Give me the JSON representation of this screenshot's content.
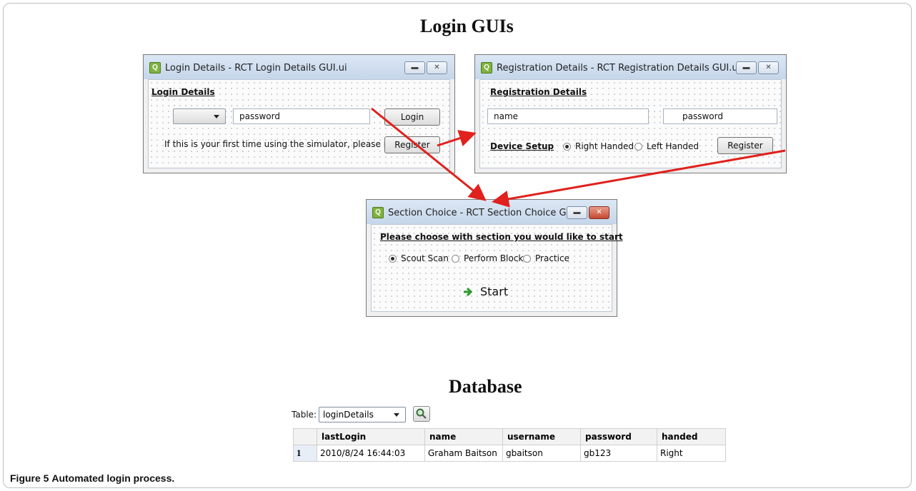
{
  "headings": {
    "top": "Login GUIs",
    "bottom": "Database"
  },
  "login_window": {
    "title": "Login Details - RCT Login Details GUI.ui",
    "section_label": "Login Details",
    "password_value": "password",
    "login_button": "Login",
    "register_prompt": "If this is your first time using the simulator, please register",
    "register_button": "Register"
  },
  "registration_window": {
    "title": "Registration Details - RCT Registration Details GUI.ui",
    "section_label": "Registration Details",
    "name_value": "name",
    "password_value": "password",
    "device_label": "Device Setup",
    "radio_right": "Right Handed",
    "radio_left": "Left Handed",
    "selected": "Right Handed",
    "register_button": "Register"
  },
  "section_window": {
    "title": "Section Choice - RCT Section Choice GUI.ui",
    "prompt": "Please choose with section you would like to start",
    "options": [
      "Scout Scan",
      "Perform Block",
      "Practice"
    ],
    "selected": "Scout Scan",
    "start_button": "Start"
  },
  "database": {
    "table_label": "Table:",
    "table_select": "loginDetails",
    "columns": [
      "lastLogin",
      "name",
      "username",
      "password",
      "handed"
    ],
    "rows": [
      {
        "num": "1",
        "cells": [
          "2010/8/24 16:44:03",
          "Graham Baitson",
          "gbaitson",
          "gb123",
          "Right"
        ]
      }
    ]
  },
  "caption": {
    "label": "Figure 5",
    "text": "Automated login process."
  },
  "colors": {
    "arrow": "#e0211d",
    "titlebar": "#c5d6ea",
    "start_arrow": "#2e9a2e"
  }
}
